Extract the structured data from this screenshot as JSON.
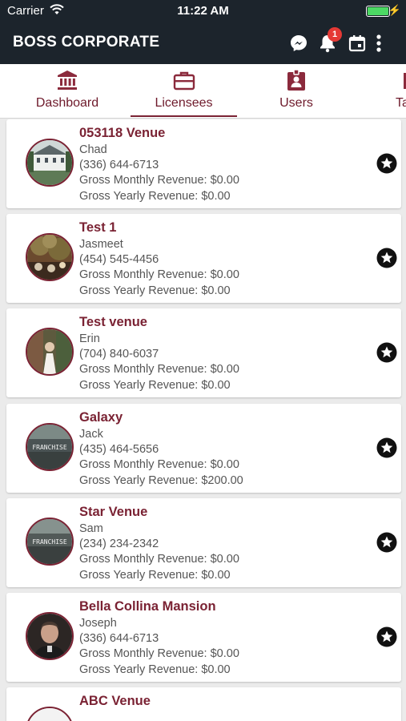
{
  "status_bar": {
    "carrier": "Carrier",
    "time": "11:22 AM"
  },
  "app_bar": {
    "title": "BOSS CORPORATE",
    "notification_count": "1"
  },
  "tabs": [
    {
      "label": "Dashboard",
      "icon": "bank-icon"
    },
    {
      "label": "Licensees",
      "icon": "briefcase-icon",
      "active": true
    },
    {
      "label": "Users",
      "icon": "badge-icon"
    },
    {
      "label": "Ta",
      "icon": "tab-icon"
    }
  ],
  "labels": {
    "monthly": "Gross Monthly Revenue:",
    "yearly": "Gross Yearly Revenue:"
  },
  "licensees": [
    {
      "name": "053118 Venue",
      "contact": "Chad",
      "phone": "(336) 644-6713",
      "monthly": "Gross Monthly Revenue: $0.00",
      "yearly": "Gross Yearly Revenue: $0.00",
      "avatar": "mansion"
    },
    {
      "name": "Test 1",
      "contact": "Jasmeet",
      "phone": "(454) 545-4456",
      "monthly": "Gross Monthly Revenue: $0.00",
      "yearly": "Gross Yearly Revenue: $0.00",
      "avatar": "garden"
    },
    {
      "name": "Test venue",
      "contact": "Erin",
      "phone": "(704) 840-6037",
      "monthly": "Gross Monthly Revenue: $0.00",
      "yearly": "Gross Yearly Revenue: $0.00",
      "avatar": "couple"
    },
    {
      "name": "Galaxy",
      "contact": "Jack",
      "phone": "(435) 464-5656",
      "monthly": "Gross Monthly Revenue: $0.00",
      "yearly": "Gross Yearly Revenue: $200.00",
      "avatar": "franchise",
      "avatar_text": "FRANCHISE"
    },
    {
      "name": "Star Venue",
      "contact": "Sam",
      "phone": "(234) 234-2342",
      "monthly": "Gross Monthly Revenue: $0.00",
      "yearly": "Gross Yearly Revenue: $0.00",
      "avatar": "franchise",
      "avatar_text": "FRANCHISE"
    },
    {
      "name": "Bella Collina Mansion",
      "contact": "Joseph",
      "phone": "(336) 644-6713",
      "monthly": "Gross Monthly Revenue: $0.00",
      "yearly": "Gross Yearly Revenue: $0.00",
      "avatar": "person"
    },
    {
      "name": "ABC Venue",
      "contact": "",
      "phone": "",
      "monthly": "",
      "yearly": "",
      "avatar": "partial"
    }
  ],
  "colors": {
    "accent": "#7a2233",
    "appbar": "#1c242c",
    "badge": "#e53935",
    "battery": "#4cd964"
  }
}
